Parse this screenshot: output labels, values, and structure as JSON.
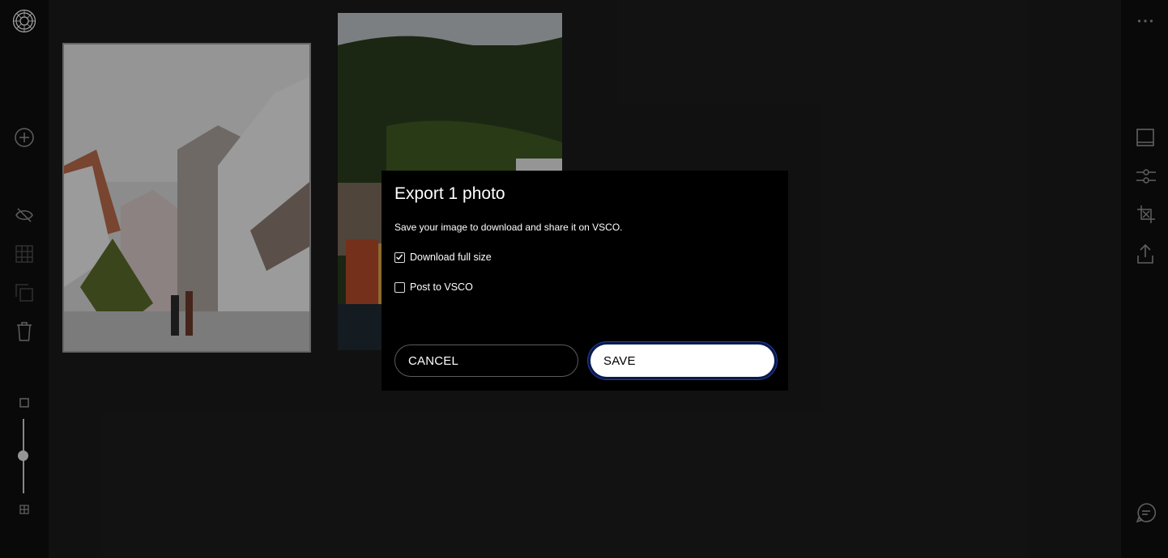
{
  "modal": {
    "title": "Export 1 photo",
    "description": "Save your image to download and share it on VSCO.",
    "options": [
      {
        "label": "Download full size",
        "checked": true
      },
      {
        "label": "Post to VSCO",
        "checked": false
      }
    ],
    "cancel_label": "CANCEL",
    "save_label": "SAVE"
  },
  "left_rail": {
    "icons": [
      "vsco-logo-icon",
      "add-icon",
      "hide-icon",
      "grid-icon",
      "copy-icon",
      "trash-icon",
      "small-square-icon",
      "grid-large-icon"
    ]
  },
  "right_rail": {
    "icons": [
      "more-icon",
      "frame-icon",
      "adjust-sliders-icon",
      "crop-icon",
      "export-icon",
      "comment-icon"
    ]
  },
  "photos": [
    {
      "subject": "street with white houses"
    },
    {
      "subject": "hillside with colorful houses"
    }
  ],
  "colors": {
    "accent_focus": "#1e3ea5",
    "modal_bg": "#000000",
    "rail_bg": "#0e0e0e"
  }
}
